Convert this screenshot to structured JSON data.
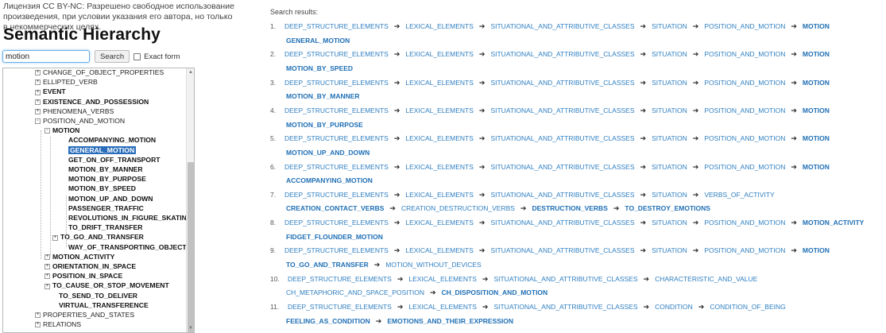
{
  "license": "Лицензия CC BY-NC: Разрешено свободное использование произведения, при условии указания его автора, но только в некоммерческих целях.",
  "title": "Semantic Hierarchy",
  "search": {
    "value": "motion",
    "button": "Search",
    "exact_label": "Exact form"
  },
  "results_heading": "Search results:",
  "tree": [
    {
      "label": "CHANGE_OF_OBJECT_PROPERTIES",
      "bold": false,
      "exp": "+",
      "level": 0
    },
    {
      "label": "ELLIPTED_VERB",
      "bold": false,
      "exp": "+",
      "level": 0
    },
    {
      "label": "EVENT",
      "bold": true,
      "exp": "+",
      "level": 0
    },
    {
      "label": "EXISTENCE_AND_POSSESSION",
      "bold": true,
      "exp": "+",
      "level": 0
    },
    {
      "label": "PHENOMENA_VERBS",
      "bold": false,
      "exp": "+",
      "level": 0
    },
    {
      "label": "POSITION_AND_MOTION",
      "bold": false,
      "exp": "-",
      "level": 0
    },
    {
      "label": "MOTION",
      "bold": true,
      "exp": "-",
      "level": 1
    },
    {
      "label": "ACCOMPANYING_MOTION",
      "bold": true,
      "exp": "",
      "level": 2
    },
    {
      "label": "GENERAL_MOTION",
      "bold": true,
      "exp": "",
      "level": 2,
      "selected": true
    },
    {
      "label": "GET_ON_OFF_TRANSPORT",
      "bold": true,
      "exp": "",
      "level": 2
    },
    {
      "label": "MOTION_BY_MANNER",
      "bold": true,
      "exp": "",
      "level": 2
    },
    {
      "label": "MOTION_BY_PURPOSE",
      "bold": true,
      "exp": "",
      "level": 2
    },
    {
      "label": "MOTION_BY_SPEED",
      "bold": true,
      "exp": "",
      "level": 2
    },
    {
      "label": "MOTION_UP_AND_DOWN",
      "bold": true,
      "exp": "",
      "level": 2
    },
    {
      "label": "PASSENGER_TRAFFIC",
      "bold": true,
      "exp": "",
      "level": 2
    },
    {
      "label": "REVOLUTIONS_IN_FIGURE_SKATING",
      "bold": true,
      "exp": "",
      "level": 2
    },
    {
      "label": "TO_DRIFT_TRANSFER",
      "bold": true,
      "exp": "",
      "level": 2
    },
    {
      "label": "TO_GO_AND_TRANSFER",
      "bold": true,
      "exp": "+",
      "level": 1.5
    },
    {
      "label": "WAY_OF_TRANSPORTING_OBJECT",
      "bold": true,
      "exp": "",
      "level": 2
    },
    {
      "label": "MOTION_ACTIVITY",
      "bold": true,
      "exp": "+",
      "level": 1
    },
    {
      "label": "ORIENTATION_IN_SPACE",
      "bold": true,
      "exp": "+",
      "level": 1
    },
    {
      "label": "POSITION_IN_SPACE",
      "bold": true,
      "exp": "+",
      "level": 1
    },
    {
      "label": "TO_CAUSE_OR_STOP_MOVEMENT",
      "bold": true,
      "exp": "+",
      "level": 1
    },
    {
      "label": "TO_SEND_TO_DELIVER",
      "bold": true,
      "exp": "",
      "level": 1.4
    },
    {
      "label": "VIRTUAL_TRANSFERENCE",
      "bold": true,
      "exp": "",
      "level": 1.4
    },
    {
      "label": "PROPERTIES_AND_STATES",
      "bold": false,
      "exp": "+",
      "level": 0
    },
    {
      "label": "RELATIONS",
      "bold": false,
      "exp": "+",
      "level": 0
    }
  ],
  "results": [
    {
      "n": "1.",
      "rows": [
        [
          [
            "DEEP_STRUCTURE_ELEMENTS",
            0
          ],
          [
            "LEXICAL_ELEMENTS",
            0
          ],
          [
            "SITUATIONAL_AND_ATTRIBUTIVE_CLASSES",
            0
          ],
          [
            "SITUATION",
            0
          ],
          [
            "POSITION_AND_MOTION",
            0
          ],
          [
            "MOTION",
            1
          ]
        ],
        [
          [
            "GENERAL_MOTION",
            1
          ]
        ]
      ]
    },
    {
      "n": "2.",
      "rows": [
        [
          [
            "DEEP_STRUCTURE_ELEMENTS",
            0
          ],
          [
            "LEXICAL_ELEMENTS",
            0
          ],
          [
            "SITUATIONAL_AND_ATTRIBUTIVE_CLASSES",
            0
          ],
          [
            "SITUATION",
            0
          ],
          [
            "POSITION_AND_MOTION",
            0
          ],
          [
            "MOTION",
            1
          ]
        ],
        [
          [
            "MOTION_BY_SPEED",
            1
          ]
        ]
      ]
    },
    {
      "n": "3.",
      "rows": [
        [
          [
            "DEEP_STRUCTURE_ELEMENTS",
            0
          ],
          [
            "LEXICAL_ELEMENTS",
            0
          ],
          [
            "SITUATIONAL_AND_ATTRIBUTIVE_CLASSES",
            0
          ],
          [
            "SITUATION",
            0
          ],
          [
            "POSITION_AND_MOTION",
            0
          ],
          [
            "MOTION",
            1
          ]
        ],
        [
          [
            "MOTION_BY_MANNER",
            1
          ]
        ]
      ]
    },
    {
      "n": "4.",
      "rows": [
        [
          [
            "DEEP_STRUCTURE_ELEMENTS",
            0
          ],
          [
            "LEXICAL_ELEMENTS",
            0
          ],
          [
            "SITUATIONAL_AND_ATTRIBUTIVE_CLASSES",
            0
          ],
          [
            "SITUATION",
            0
          ],
          [
            "POSITION_AND_MOTION",
            0
          ],
          [
            "MOTION",
            1
          ]
        ],
        [
          [
            "MOTION_BY_PURPOSE",
            1
          ]
        ]
      ]
    },
    {
      "n": "5.",
      "rows": [
        [
          [
            "DEEP_STRUCTURE_ELEMENTS",
            0
          ],
          [
            "LEXICAL_ELEMENTS",
            0
          ],
          [
            "SITUATIONAL_AND_ATTRIBUTIVE_CLASSES",
            0
          ],
          [
            "SITUATION",
            0
          ],
          [
            "POSITION_AND_MOTION",
            0
          ],
          [
            "MOTION",
            1
          ]
        ],
        [
          [
            "MOTION_UP_AND_DOWN",
            1
          ]
        ]
      ]
    },
    {
      "n": "6.",
      "rows": [
        [
          [
            "DEEP_STRUCTURE_ELEMENTS",
            0
          ],
          [
            "LEXICAL_ELEMENTS",
            0
          ],
          [
            "SITUATIONAL_AND_ATTRIBUTIVE_CLASSES",
            0
          ],
          [
            "SITUATION",
            0
          ],
          [
            "POSITION_AND_MOTION",
            0
          ],
          [
            "MOTION",
            1
          ]
        ],
        [
          [
            "ACCOMPANYING_MOTION",
            1
          ]
        ]
      ]
    },
    {
      "n": "7.",
      "rows": [
        [
          [
            "DEEP_STRUCTURE_ELEMENTS",
            0
          ],
          [
            "LEXICAL_ELEMENTS",
            0
          ],
          [
            "SITUATIONAL_AND_ATTRIBUTIVE_CLASSES",
            0
          ],
          [
            "SITUATION",
            0
          ],
          [
            "VERBS_OF_ACTIVITY",
            0
          ]
        ],
        [
          [
            "CREATION_CONTACT_VERBS",
            1
          ],
          [
            "CREATION_DESTRUCTION_VERBS",
            0
          ],
          [
            "DESTRUCTION_VERBS",
            1
          ],
          [
            "TO_DESTROY_EMOTIONS",
            1
          ]
        ]
      ]
    },
    {
      "n": "8.",
      "rows": [
        [
          [
            "DEEP_STRUCTURE_ELEMENTS",
            0
          ],
          [
            "LEXICAL_ELEMENTS",
            0
          ],
          [
            "SITUATIONAL_AND_ATTRIBUTIVE_CLASSES",
            0
          ],
          [
            "SITUATION",
            0
          ],
          [
            "POSITION_AND_MOTION",
            0
          ],
          [
            "MOTION_ACTIVITY",
            1
          ]
        ],
        [
          [
            "FIDGET_FLOUNDER_MOTION",
            1
          ]
        ]
      ]
    },
    {
      "n": "9.",
      "rows": [
        [
          [
            "DEEP_STRUCTURE_ELEMENTS",
            0
          ],
          [
            "LEXICAL_ELEMENTS",
            0
          ],
          [
            "SITUATIONAL_AND_ATTRIBUTIVE_CLASSES",
            0
          ],
          [
            "SITUATION",
            0
          ],
          [
            "POSITION_AND_MOTION",
            0
          ],
          [
            "MOTION",
            1
          ]
        ],
        [
          [
            "TO_GO_AND_TRANSFER",
            1
          ],
          [
            "MOTION_WITHOUT_DEVICES",
            0
          ]
        ]
      ]
    },
    {
      "n": "10.",
      "rows": [
        [
          [
            "DEEP_STRUCTURE_ELEMENTS",
            0
          ],
          [
            "LEXICAL_ELEMENTS",
            0
          ],
          [
            "SITUATIONAL_AND_ATTRIBUTIVE_CLASSES",
            0
          ],
          [
            "CHARACTERISTIC_AND_VALUE",
            0
          ]
        ],
        [
          [
            "CH_METAPHORIC_AND_SPACE_POSITION",
            0
          ],
          [
            "CH_DISPOSITION_AND_MOTION",
            1
          ]
        ]
      ]
    },
    {
      "n": "11.",
      "rows": [
        [
          [
            "DEEP_STRUCTURE_ELEMENTS",
            0
          ],
          [
            "LEXICAL_ELEMENTS",
            0
          ],
          [
            "SITUATIONAL_AND_ATTRIBUTIVE_CLASSES",
            0
          ],
          [
            "CONDITION",
            0
          ],
          [
            "CONDITION_OF_BEING",
            0
          ]
        ],
        [
          [
            "FEELING_AS_CONDITION",
            1
          ],
          [
            "EMOTIONS_AND_THEIR_EXPRESSION",
            1
          ]
        ]
      ]
    }
  ],
  "arrow_glyph": "➔"
}
